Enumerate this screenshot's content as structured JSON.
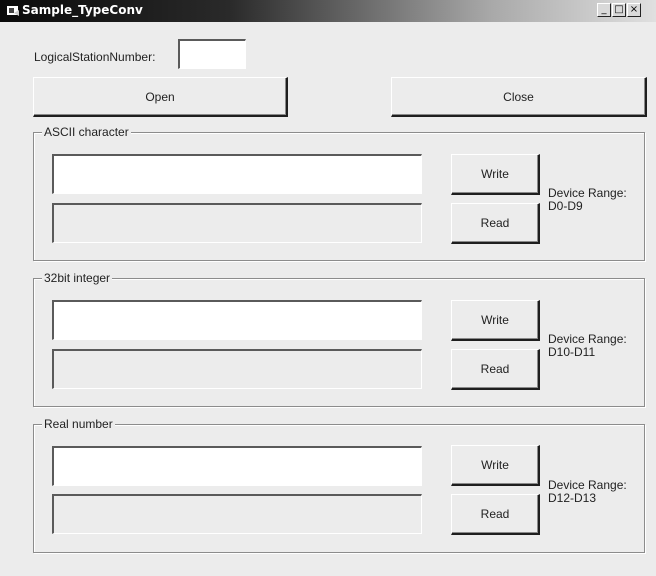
{
  "window": {
    "title": "Sample_TypeConv",
    "controls": {
      "minimize": "_",
      "maximize": "□",
      "close": "×"
    }
  },
  "station": {
    "label": "LogicalStationNumber:",
    "value": ""
  },
  "buttons": {
    "open": "Open",
    "close": "Close"
  },
  "groups": [
    {
      "title": "ASCII character",
      "write_label": "Write",
      "read_label": "Read",
      "range_label": "Device Range:",
      "range_value": "D0-D9",
      "input_value": "",
      "output_value": ""
    },
    {
      "title": "32bit integer",
      "write_label": "Write",
      "read_label": "Read",
      "range_label": "Device Range:",
      "range_value": "D10-D11",
      "input_value": "",
      "output_value": ""
    },
    {
      "title": "Real number",
      "write_label": "Write",
      "read_label": "Read",
      "range_label": "Device Range:",
      "range_value": "D12-D13",
      "input_value": "",
      "output_value": ""
    }
  ],
  "icons": {
    "app": "app-icon"
  }
}
